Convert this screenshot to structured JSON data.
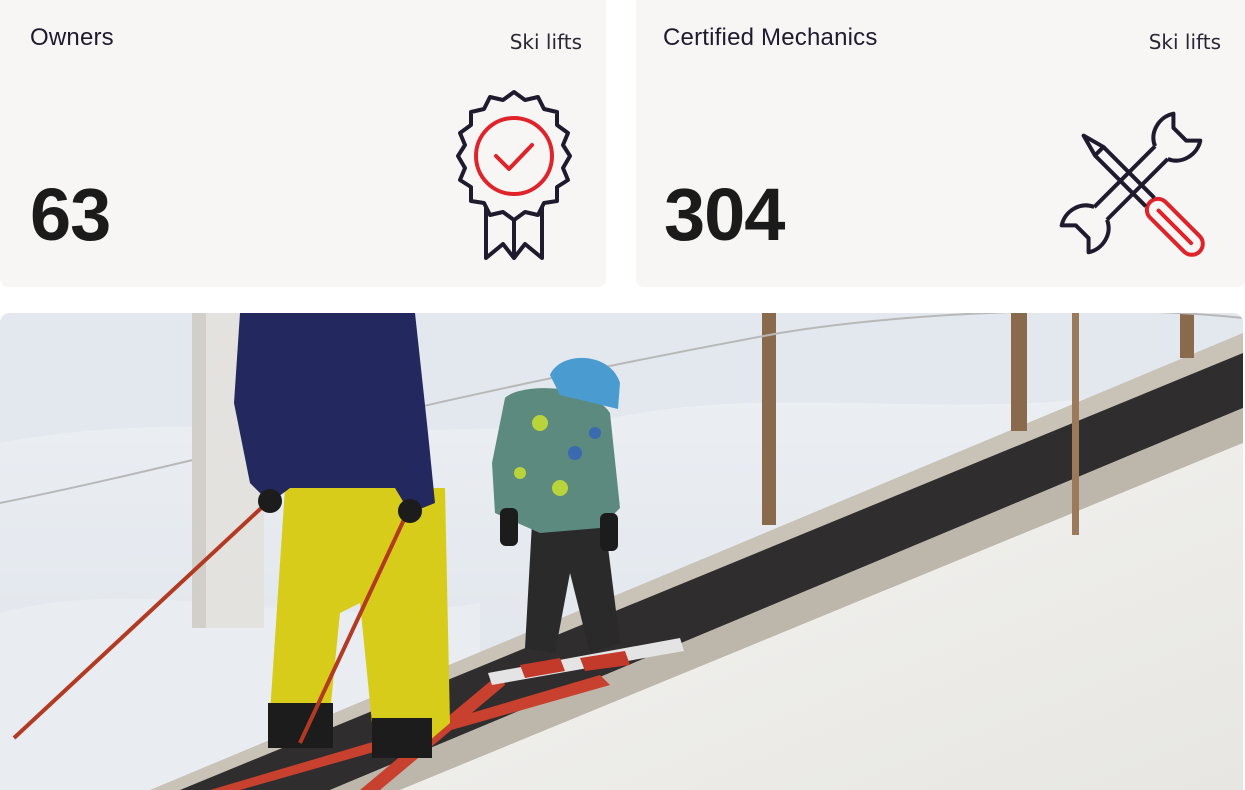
{
  "cards": [
    {
      "title": "Owners",
      "tag": "Ski lifts",
      "value": "63",
      "icon": "award-badge-checkmark-icon"
    },
    {
      "title": "Certified Mechanics",
      "tag": "Ski lifts",
      "value": "304",
      "icon": "wrench-screwdriver-icon"
    }
  ],
  "colors": {
    "card_bg": "#f7f6f4",
    "icon_dark": "#1f1a2e",
    "icon_accent": "#e0232b",
    "number": "#1b1b1b"
  },
  "photo": {
    "subject": "adult and child skiers riding a conveyor carpet lift on snow"
  }
}
